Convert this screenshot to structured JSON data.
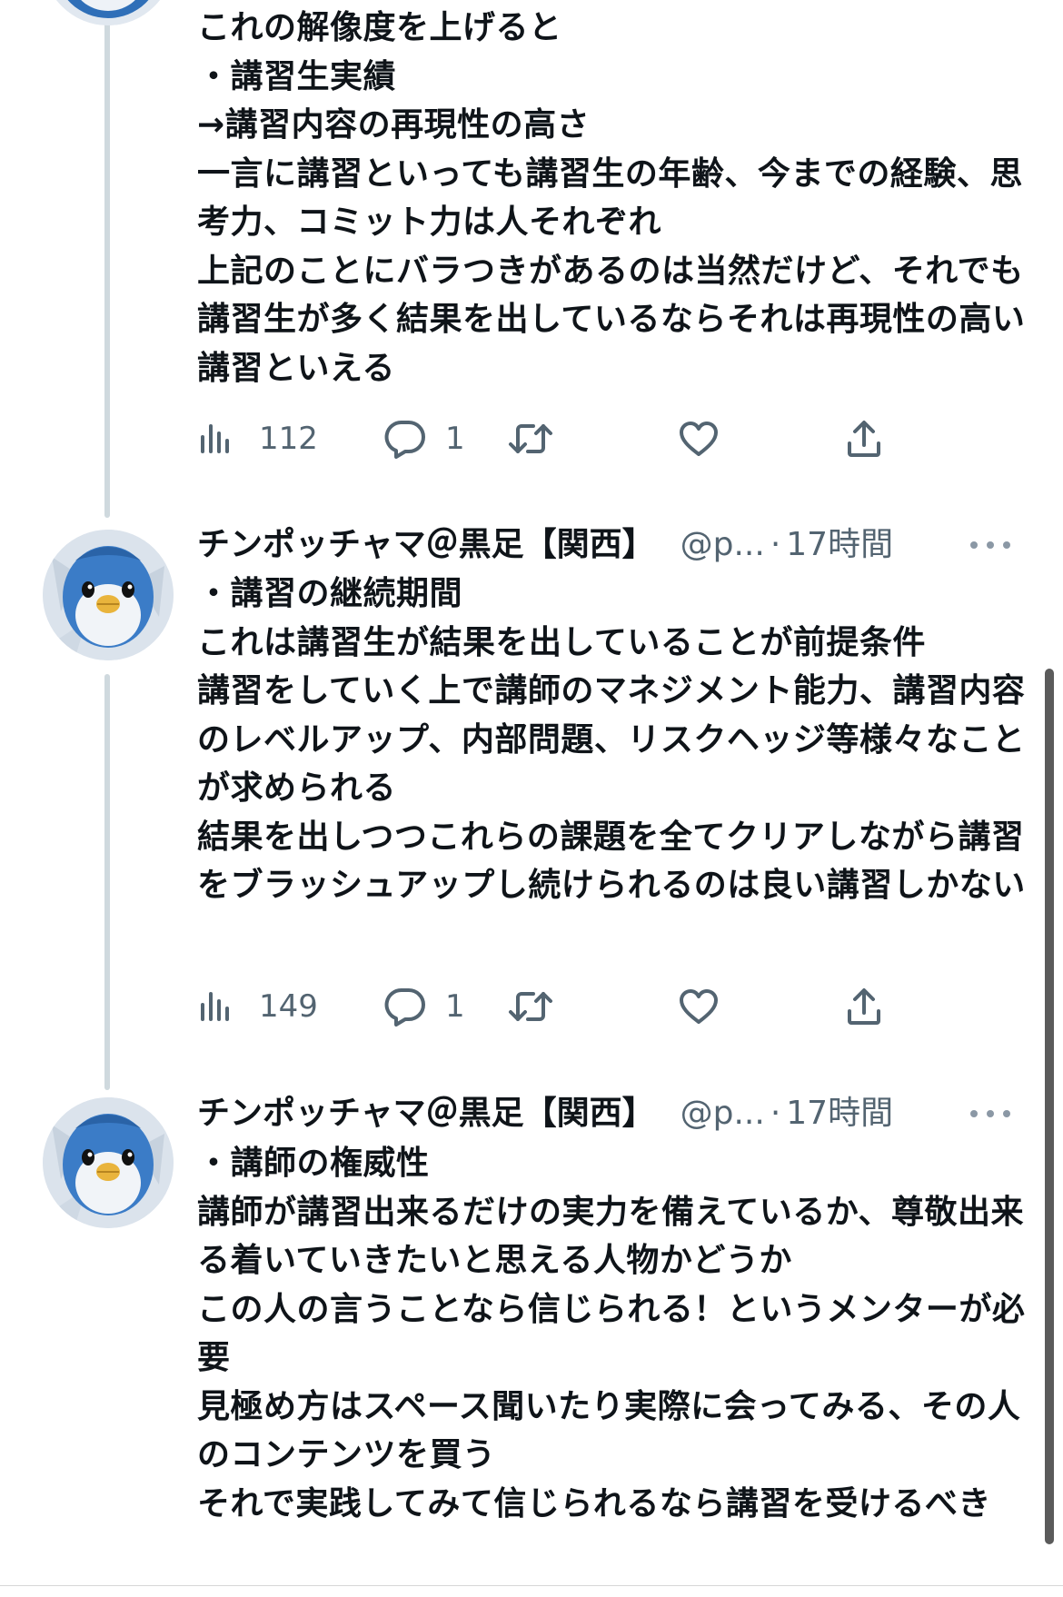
{
  "tweets": [
    {
      "text": "これの解像度を上げると\n・講習生実績\n→講習内容の再現性の高さ\n一言に講習といっても講習生の年齢、今までの経験、思考力、コミット力は人それぞれ\n上記のことにバラつきがあるのは当然だけど、それでも講習生が多く結果を出しているならそれは再現性の高い講習といえる",
      "views": "112",
      "replies": "1"
    },
    {
      "display_name": "チンポッチャマ＠黒足【関西】",
      "handle": "@p...",
      "separator": "·",
      "time": "17時間",
      "text": "・講習の継続期間\nこれは講習生が結果を出していることが前提条件\n講習をしていく上で講師のマネジメント能力、講習内容のレベルアップ、内部問題、リスクヘッジ等様々なことが求められる\n結果を出しつつこれらの課題を全てクリアしながら講習をブラッシュアップし続けられるのは良い講習しかない",
      "views": "149",
      "replies": "1"
    },
    {
      "display_name": "チンポッチャマ＠黒足【関西】",
      "handle": "@p...",
      "separator": "·",
      "time": "17時間",
      "text": "・講師の権威性\n講師が講習出来るだけの実力を備えているか、尊敬出来る着いていきたいと思える人物かどうか\nこの人の言うことなら信じられる！というメンターが必要\n見極め方はスペース聞いたり実際に会ってみる、その人のコンテンツを買う\nそれで実践してみて信じられるなら講習を受けるべき"
    }
  ],
  "colors": {
    "text": "#0f1419",
    "secondary": "#536471",
    "thread_line": "#cfd9de"
  },
  "icons": [
    "views-icon",
    "reply-icon",
    "retweet-icon",
    "like-icon",
    "share-icon",
    "more-icon",
    "avatar"
  ]
}
